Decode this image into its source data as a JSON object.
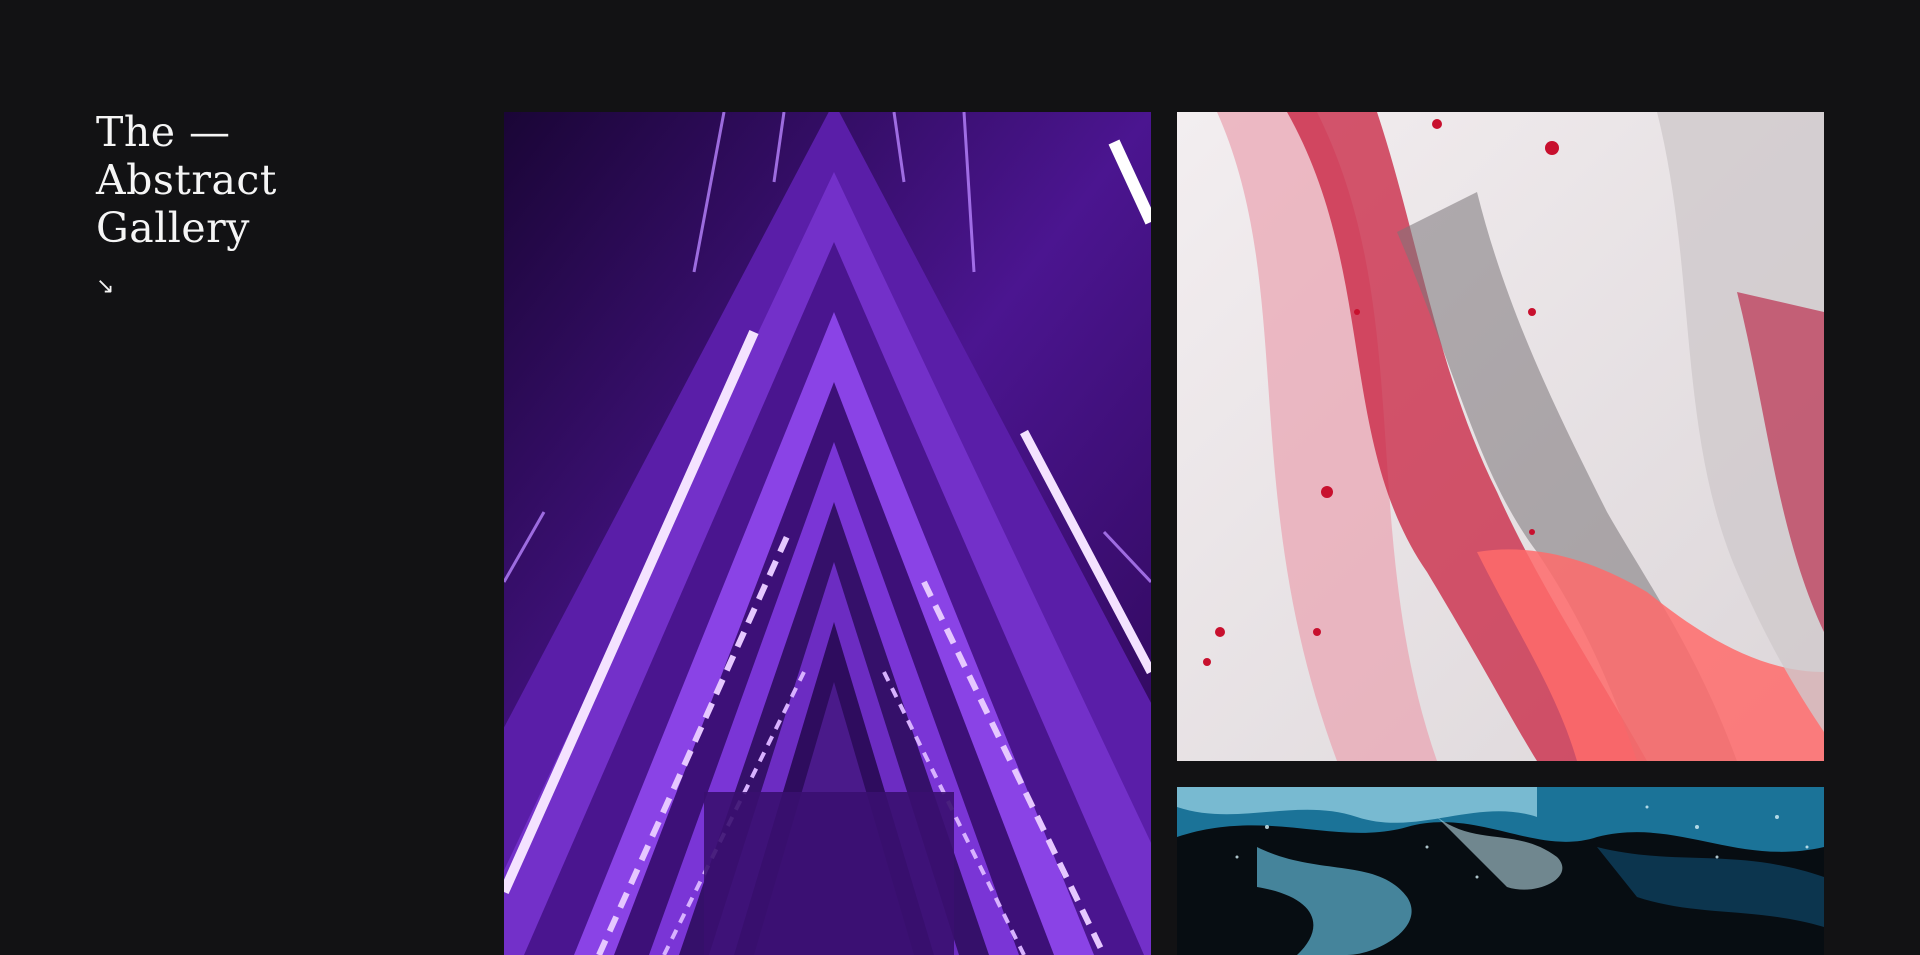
{
  "site": {
    "title_lines": [
      "The —",
      "Abstract",
      "Gallery"
    ],
    "scroll_arrow": "↘"
  },
  "gallery": {
    "items": [
      {
        "theme": "purple-neon-triangles",
        "colors": [
          "#1a0536",
          "#7a2fd4",
          "#c58bff",
          "#f2dcff"
        ]
      },
      {
        "theme": "pink-marble-fluid",
        "colors": [
          "#ece8ea",
          "#c21a3c",
          "#ff6a6a",
          "#2a2a2a"
        ]
      },
      {
        "theme": "blue-ocean-fluid",
        "colors": [
          "#070d12",
          "#2a9ec8",
          "#bfe6f2",
          "#0d3a55"
        ]
      }
    ]
  }
}
